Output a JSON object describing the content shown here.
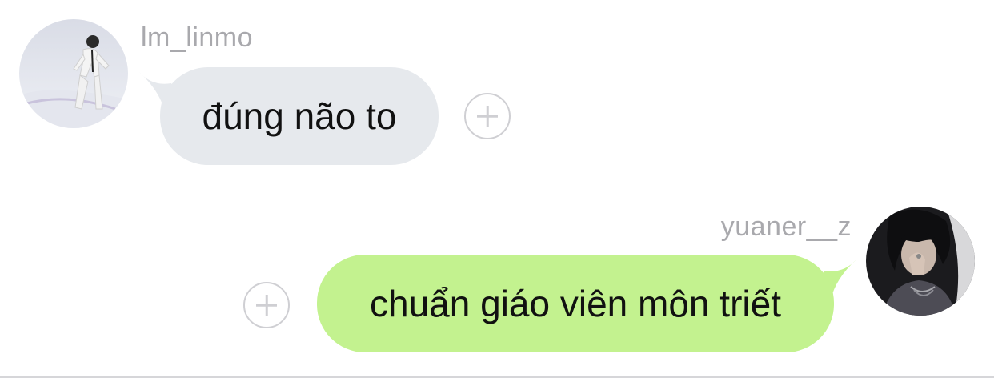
{
  "messages": [
    {
      "sender": "lm_linmo",
      "text": "đúng não to",
      "direction": "incoming",
      "avatar_icon": "figure-skater-avatar",
      "bubble_color": "#e6e9ed"
    },
    {
      "sender": "yuaner__z",
      "text": "chuẩn giáo viên môn triết",
      "direction": "outgoing",
      "avatar_icon": "dark-portrait-avatar",
      "bubble_color": "#c3f28f"
    }
  ],
  "colors": {
    "username": "#a9a9ad",
    "add_button": "#cfcfd3",
    "divider": "#d6d6d9"
  }
}
